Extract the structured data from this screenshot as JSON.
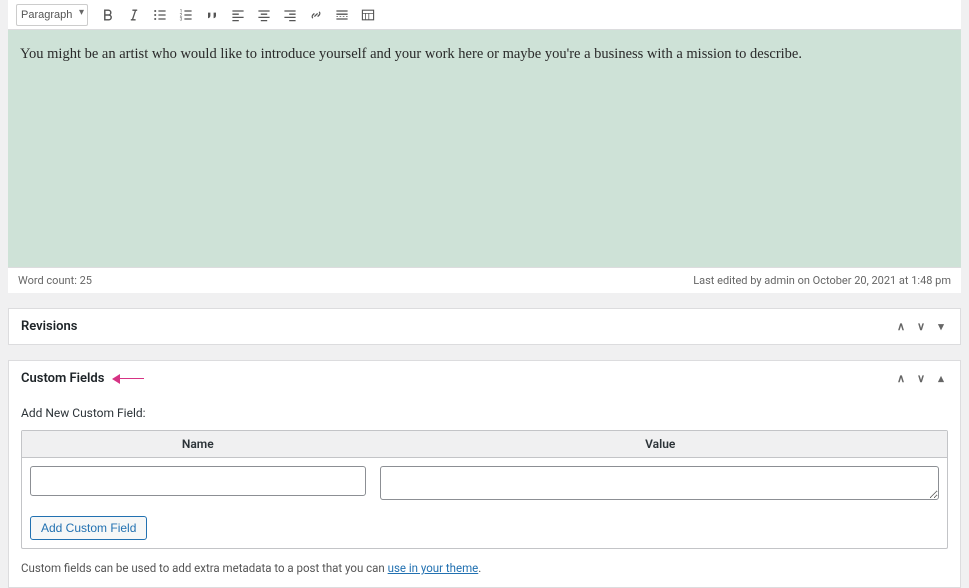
{
  "toolbar": {
    "format_option": "Paragraph"
  },
  "editor": {
    "content": "You might be an artist who would like to introduce yourself and your work here or maybe you're a business with a mission to describe.",
    "word_count_label": "Word count: 25",
    "last_edited_label": "Last edited by admin on October 20, 2021 at 1:48 pm"
  },
  "panels": {
    "revisions": {
      "title": "Revisions"
    },
    "custom_fields": {
      "title": "Custom Fields",
      "add_new_label": "Add New Custom Field:",
      "name_header": "Name",
      "value_header": "Value",
      "add_button": "Add Custom Field",
      "help_prefix": "Custom fields can be used to add extra metadata to a post that you can ",
      "help_link": "use in your theme",
      "help_suffix": "."
    }
  }
}
